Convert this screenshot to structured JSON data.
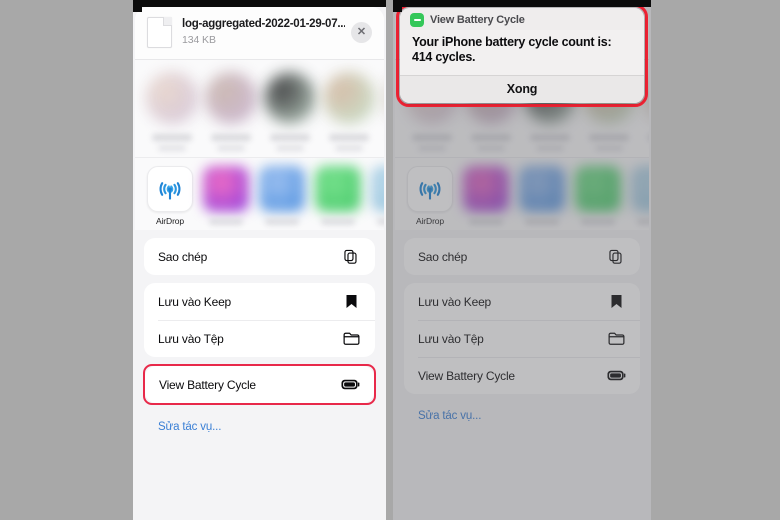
{
  "background_color": "#a8a8a8",
  "accent_red": "#e8294a",
  "alert_red": "#ef2233",
  "link_blue": "#3a7fd5",
  "shortcut_green": "#34c759",
  "left_panel": {
    "file": {
      "name": "log-aggregated-2022-01-29-07...",
      "size": "134 KB",
      "doc_icon": "document-icon",
      "close_icon": "✕"
    },
    "contacts": [
      {
        "name": "contact-1",
        "color1": "#e8d6cc",
        "color2": "#cfc0d8"
      },
      {
        "name": "contact-2",
        "color1": "#c9b6ae",
        "color2": "#c7b0d2"
      },
      {
        "name": "contact-3",
        "color1": "#3a3a3c",
        "color2": "#b9cfc0"
      },
      {
        "name": "contact-4",
        "color1": "#d5b9a4",
        "color2": "#bfe0c6"
      },
      {
        "name": "contact-5",
        "color1": "#e2ddd6",
        "color2": "#d8d2cc"
      }
    ],
    "apps": [
      {
        "name": "AirDrop",
        "icon": "airdrop-icon",
        "blurred": false
      },
      {
        "name": "app-2",
        "icon": "app-icon",
        "blurred": true,
        "color1": "#f06ec4",
        "color2": "#8a3ce0"
      },
      {
        "name": "app-3",
        "icon": "app-icon",
        "blurred": true,
        "color1": "#9dc0f0",
        "color2": "#4a8ede"
      },
      {
        "name": "app-4",
        "icon": "app-icon",
        "blurred": true,
        "color1": "#76e08c",
        "color2": "#46c96a"
      },
      {
        "name": "app-5",
        "icon": "app-icon",
        "blurred": true,
        "color1": "#b8d8ea",
        "color2": "#98c4dd"
      }
    ],
    "action_groups": [
      {
        "rows": [
          {
            "label": "Sao chép",
            "icon": "copy-icon",
            "highlighted": false
          }
        ]
      },
      {
        "rows": [
          {
            "label": "Lưu vào Keep",
            "icon": "bookmark-icon",
            "highlighted": false
          },
          {
            "label": "Lưu vào Tệp",
            "icon": "folder-icon",
            "highlighted": false
          }
        ]
      },
      {
        "rows": [
          {
            "label": "View Battery Cycle",
            "icon": "battery-icon",
            "highlighted": true
          }
        ]
      }
    ],
    "edit_actions_label": "Sửa tác vụ..."
  },
  "right_panel": {
    "alert": {
      "app_icon": "shortcuts-icon",
      "title": "View Battery Cycle",
      "message": "Your iPhone battery cycle count is: 414 cycles.",
      "button_label": "Xong",
      "battery_cycle_count": "414"
    },
    "file": {
      "name": "log-aggregated-2022-01-29-07...",
      "size": "134 KB",
      "doc_icon": "document-icon",
      "close_icon": "✕"
    },
    "contacts": [
      {
        "name": "contact-1",
        "color1": "#e8d6cc",
        "color2": "#cfc0d8"
      },
      {
        "name": "contact-2",
        "color1": "#c9b6ae",
        "color2": "#c7b0d2"
      },
      {
        "name": "contact-3",
        "color1": "#3a3a3c",
        "color2": "#b9cfc0"
      },
      {
        "name": "contact-4",
        "color1": "#d5b9a4",
        "color2": "#bfe0c6"
      },
      {
        "name": "contact-5",
        "color1": "#e2ddd6",
        "color2": "#d8d2cc"
      }
    ],
    "apps": [
      {
        "name": "AirDrop",
        "icon": "airdrop-icon",
        "blurred": false
      },
      {
        "name": "app-2",
        "icon": "app-icon",
        "blurred": true,
        "color1": "#f06ec4",
        "color2": "#8a3ce0"
      },
      {
        "name": "app-3",
        "icon": "app-icon",
        "blurred": true,
        "color1": "#9dc0f0",
        "color2": "#4a8ede"
      },
      {
        "name": "app-4",
        "icon": "app-icon",
        "blurred": true,
        "color1": "#76e08c",
        "color2": "#46c96a"
      },
      {
        "name": "app-5",
        "icon": "app-icon",
        "blurred": true,
        "color1": "#b8d8ea",
        "color2": "#98c4dd"
      }
    ],
    "action_groups": [
      {
        "rows": [
          {
            "label": "Sao chép",
            "icon": "copy-icon",
            "highlighted": false
          }
        ]
      },
      {
        "rows": [
          {
            "label": "Lưu vào Keep",
            "icon": "bookmark-icon",
            "highlighted": false
          },
          {
            "label": "Lưu vào Tệp",
            "icon": "folder-icon",
            "highlighted": false
          },
          {
            "label": "View Battery Cycle",
            "icon": "battery-icon",
            "highlighted": false
          }
        ]
      }
    ],
    "edit_actions_label": "Sửa tác vụ..."
  }
}
